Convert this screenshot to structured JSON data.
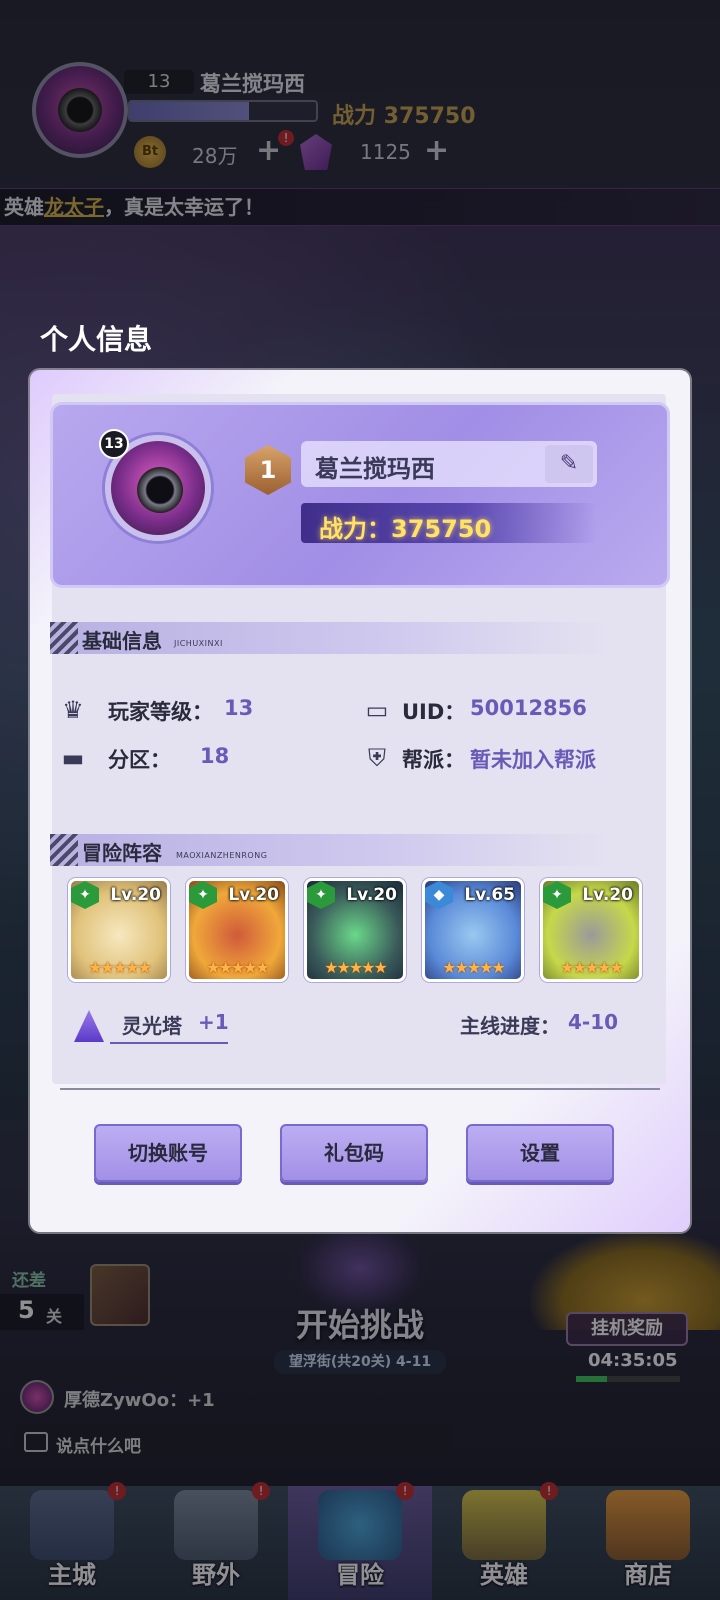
{
  "hud": {
    "level": "13",
    "player_name": "葛兰搅玛西",
    "power": "战力 375750",
    "gold_icon": "Bt",
    "gold": "28万",
    "gems": "1125",
    "plus": "+",
    "alert": "!"
  },
  "ticker": {
    "prefix": "英雄",
    "hero": "龙太子",
    "suffix": "，真是太幸运了！"
  },
  "modal": {
    "title": "个人信息",
    "profile": {
      "level_badge": "13",
      "rank": "1",
      "name": "葛兰搅玛西",
      "edit_icon": "✎",
      "power_label": "战力：375750"
    },
    "basic_info": {
      "title": "基础信息",
      "subtitle": "JICHUXINXI",
      "player_level_label": "玩家等级：",
      "player_level_value": "13",
      "uid_label": "UID：",
      "uid_value": "50012856",
      "zone_label": "分区：",
      "zone_value": "18",
      "guild_label": "帮派：",
      "guild_value": "暂未加入帮派"
    },
    "lineup": {
      "title": "冒险阵容",
      "subtitle": "MAOXIANZHENRONG",
      "heroes": [
        {
          "level": "Lv.20",
          "stars": "★★★★★",
          "type_icon": "leaf-icon",
          "color": "#e9d28a"
        },
        {
          "level": "Lv.20",
          "stars": "★★★★★",
          "type_icon": "leaf-icon",
          "color": "#f0a83a"
        },
        {
          "level": "Lv.20",
          "stars": "★★★★★",
          "type_icon": "leaf-icon",
          "color": "#3a5a5a"
        },
        {
          "level": "Lv.65",
          "stars": "★★★★★",
          "type_icon": "water-icon",
          "color": "#5a8ad8"
        },
        {
          "level": "Lv.20",
          "stars": "★★★★★",
          "type_icon": "leaf-icon",
          "color": "#c6d84a"
        }
      ],
      "tower_label": "灵光塔",
      "tower_value": "+1",
      "progress_label": "主线进度：",
      "progress_value": "4-10"
    },
    "buttons": {
      "switch_account": "切换账号",
      "gift_code": "礼包码",
      "settings": "设置"
    }
  },
  "game": {
    "remain_label": "还差",
    "remain_count": "5",
    "remain_unit": "关",
    "start_label": "开始挑战",
    "stage": "望浮街(共20关) 4-11",
    "idle_reward": "挂机奖励",
    "idle_timer": "04:35:05",
    "chat_line": "厚德ZywOo：+1",
    "chat_placeholder": "说点什么吧"
  },
  "nav": [
    {
      "label": "主城",
      "alert": "!"
    },
    {
      "label": "野外",
      "alert": "!"
    },
    {
      "label": "冒险",
      "alert": "!"
    },
    {
      "label": "英雄",
      "alert": "!"
    },
    {
      "label": "商店",
      "alert": ""
    }
  ],
  "colors": {
    "accent": "#6a5ab8",
    "power_gold": "#ffe266",
    "alert_red": "#c02a2a"
  }
}
